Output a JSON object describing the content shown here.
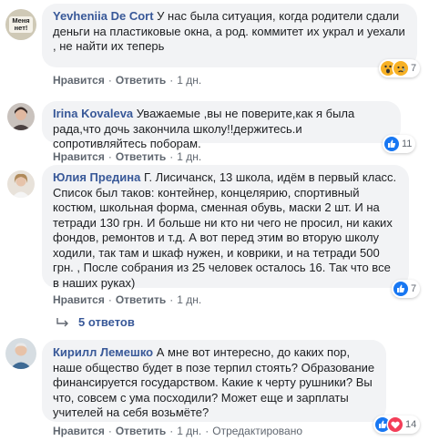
{
  "comments": [
    {
      "author": "Yevheniia De Cort",
      "avatar_text": "Меня нет!",
      "text": "У нас была ситуация, когда родители сдали деньги на пластиковые окна, а род. коммитет их украл и уехали , не найти их теперь",
      "actions": [
        "Нравится",
        "Ответить",
        "1 дн."
      ],
      "reactions": [
        "wow",
        "sad"
      ],
      "reaction_count": "7"
    },
    {
      "author": "Irina Kovaleva",
      "text": "Уважаемые ,вы не поверите,как я была рада,что дочь закончила школу!!держитесь.и сопротивляйтесь поборам.",
      "actions": [
        "Нравится",
        "Ответить",
        "1 дн."
      ],
      "reactions": [
        "like"
      ],
      "reaction_count": "11"
    },
    {
      "author": "Юлия Предина",
      "text": "Г. Лисичанск, 13 школа, идём в первый класс. Список был таков: контейнер, концелярию, спортивный костюм, школьная форма, сменная обувь, маски 2 шт. И на тетради 130 грн. И больше ни кто ни чего не просил, ни каких фондов, ремонтов и т.д. А вот перед этим во вторую школу ходили, так там и шкаф нужен, и коврики, и на тетради 500 грн. , После собрания из 25 человек осталось 16. Так что все в наших руках)",
      "actions": [
        "Нравится",
        "Ответить",
        "1 дн."
      ],
      "reactions": [
        "like"
      ],
      "reaction_count": "7",
      "replies_label": "5 ответов"
    },
    {
      "author": "Кирилл Лемешко",
      "text": "А мне вот интересно, до каких пор, наше общество будет в позе терпил стоять? Образование финансируется государством. Какие к черту рушники? Вы что, совсем с ума посходили? Может еще и зарплаты учителей на себя возьмёте?",
      "actions": [
        "Нравится",
        "Ответить",
        "1 дн.",
        "Отредактировано"
      ],
      "reactions": [
        "like",
        "love"
      ],
      "reaction_count": "14"
    }
  ],
  "colors": {
    "author": "#385898",
    "bubble_bg": "#f2f3f5",
    "meta": "#606770",
    "like": "#1877f2",
    "wow": "#f7b125",
    "love": "#f33e58"
  }
}
